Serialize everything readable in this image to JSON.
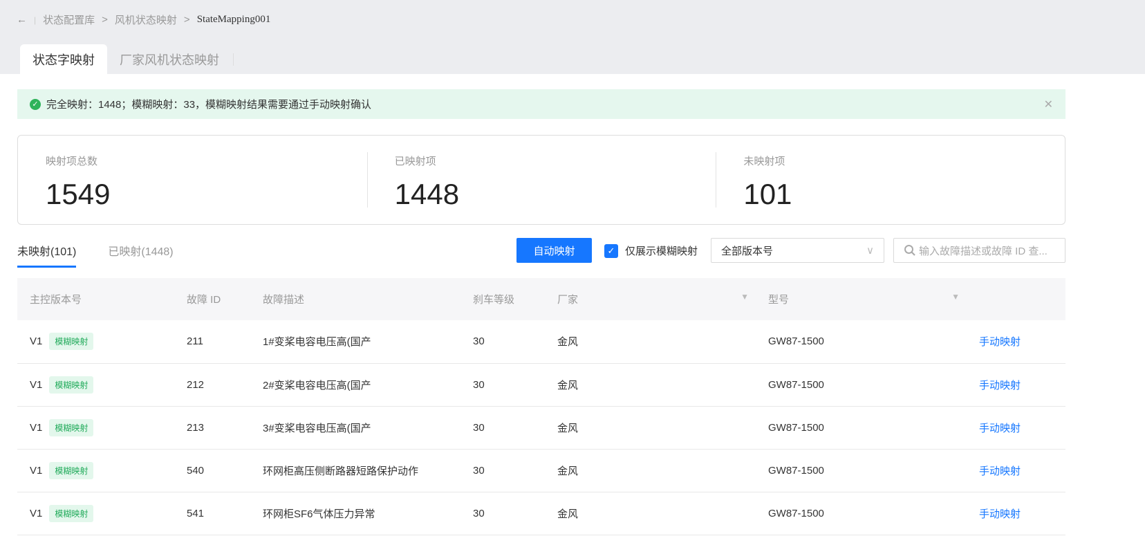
{
  "breadcrumb": [
    "状态配置库",
    "风机状态映射",
    "StateMapping001"
  ],
  "tabs": [
    "状态字映射",
    "厂家风机状态映射"
  ],
  "alert": "完全映射：1448；模糊映射：33，模糊映射结果需要通过手动映射确认",
  "stats": [
    {
      "label": "映射项总数",
      "value": "1549"
    },
    {
      "label": "已映射项",
      "value": "1448"
    },
    {
      "label": "未映射项",
      "value": "101"
    }
  ],
  "subtabs": [
    "未映射(101)",
    "已映射(1448)"
  ],
  "toolbar": {
    "auto_map": "自动映射",
    "only_fuzzy": "仅展示模糊映射",
    "version_select": "全部版本号",
    "search_placeholder": "输入故障描述或故障 ID 查..."
  },
  "columns": [
    "主控版本号",
    "故障 ID",
    "故障描述",
    "刹车等级",
    "厂家",
    "型号"
  ],
  "rows": [
    {
      "version": "V1",
      "tag": "模糊映射",
      "id": "211",
      "desc": "1#变桨电容电压高(国产",
      "brake": "30",
      "vendor": "金风",
      "model": "GW87-1500",
      "action": "手动映射"
    },
    {
      "version": "V1",
      "tag": "模糊映射",
      "id": "212",
      "desc": "2#变桨电容电压高(国产",
      "brake": "30",
      "vendor": "金风",
      "model": "GW87-1500",
      "action": "手动映射"
    },
    {
      "version": "V1",
      "tag": "模糊映射",
      "id": "213",
      "desc": "3#变桨电容电压高(国产",
      "brake": "30",
      "vendor": "金风",
      "model": "GW87-1500",
      "action": "手动映射"
    },
    {
      "version": "V1",
      "tag": "模糊映射",
      "id": "540",
      "desc": "环网柜高压侧断路器短路保护动作",
      "brake": "30",
      "vendor": "金风",
      "model": "GW87-1500",
      "action": "手动映射"
    },
    {
      "version": "V1",
      "tag": "模糊映射",
      "id": "541",
      "desc": "环网柜SF6气体压力异常",
      "brake": "30",
      "vendor": "金风",
      "model": "GW87-1500",
      "action": "手动映射"
    }
  ]
}
